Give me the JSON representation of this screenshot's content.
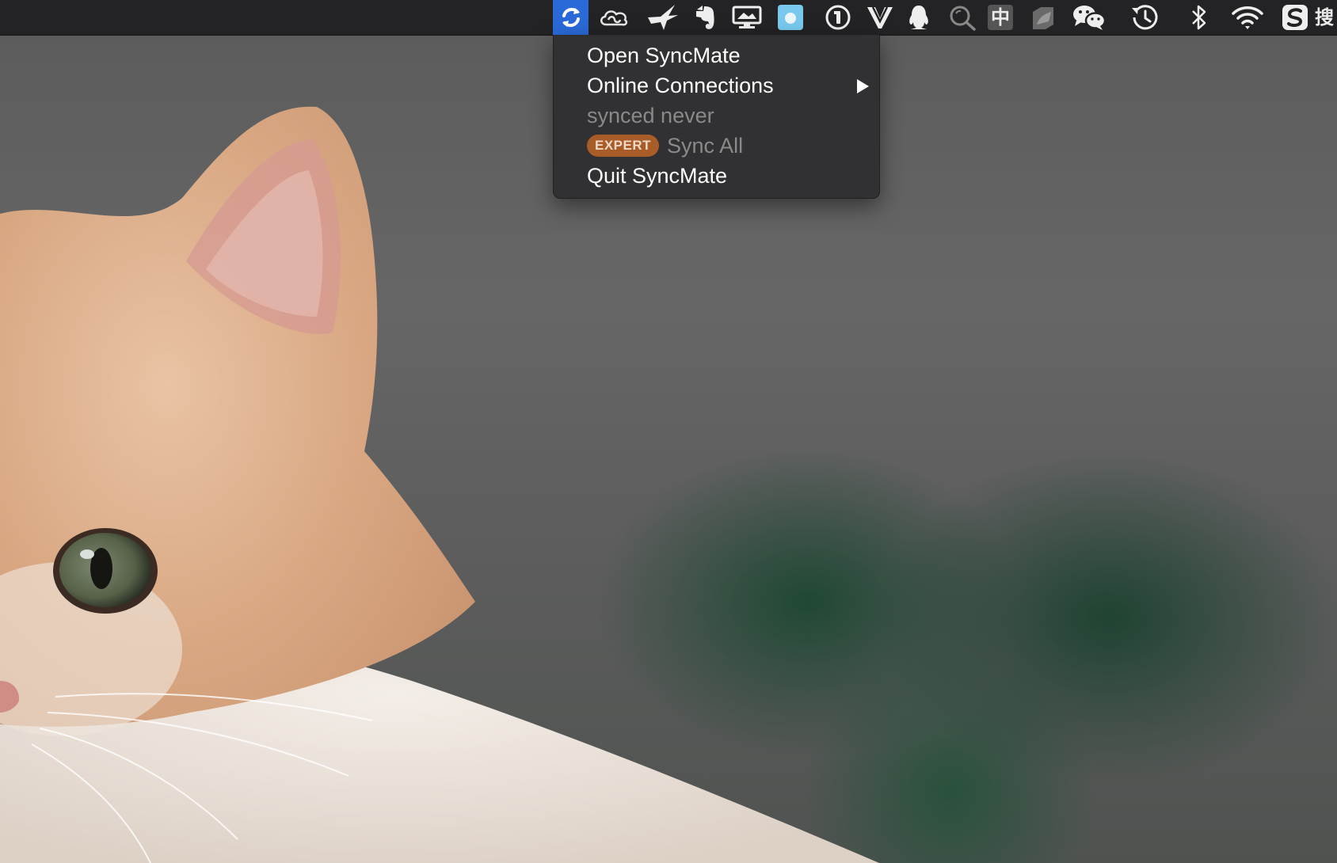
{
  "menubar": {
    "status_items": [
      {
        "icon": "syncmate-sync-icon",
        "active": true
      },
      {
        "icon": "creative-cloud-icon"
      },
      {
        "icon": "bird-icon"
      },
      {
        "icon": "evernote-icon"
      },
      {
        "icon": "display-icon"
      },
      {
        "icon": "blue-square-app-icon"
      },
      {
        "icon": "onepassword-icon"
      },
      {
        "icon": "vectorize-v-icon"
      },
      {
        "icon": "qq-penguin-icon"
      },
      {
        "icon": "magnifier-search-icon"
      },
      {
        "icon": "input-method-icon",
        "text": "中"
      },
      {
        "icon": "box-app-icon"
      },
      {
        "icon": "wechat-icon"
      },
      {
        "icon": "time-machine-icon"
      },
      {
        "icon": "bluetooth-icon"
      },
      {
        "icon": "wifi-icon"
      },
      {
        "icon": "sogou-input-icon"
      }
    ],
    "partial_text": "搜"
  },
  "dropdown": {
    "items": [
      {
        "label": "Open SyncMate",
        "enabled": true
      },
      {
        "label": "Online Connections",
        "enabled": true,
        "has_submenu": true
      },
      {
        "label": "synced never",
        "enabled": false
      },
      {
        "badge": "EXPERT",
        "label": "Sync All",
        "enabled": false
      },
      {
        "label": "Quit SyncMate",
        "enabled": true
      }
    ]
  },
  "colors": {
    "menubar_bg": "#232325",
    "active_item_bg": "#2a6ad8",
    "menu_bg": "#303032",
    "disabled_text": "#8a8a8a",
    "expert_badge": "#a85c28"
  }
}
